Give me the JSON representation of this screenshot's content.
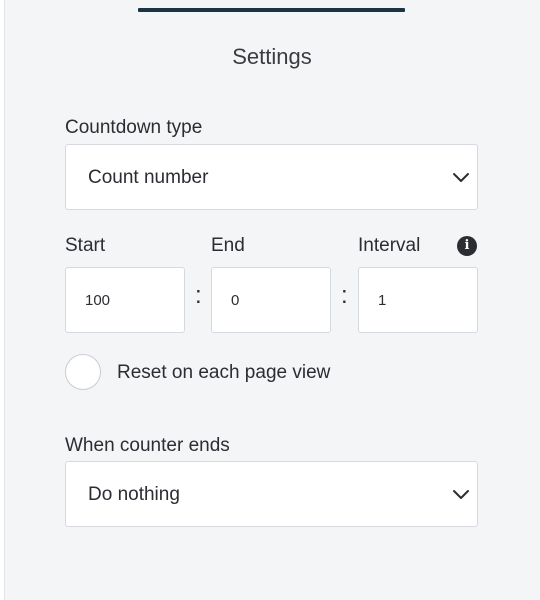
{
  "settings": {
    "title": "Settings",
    "countdown_type": {
      "label": "Countdown type",
      "selected": "Count number"
    },
    "start": {
      "label": "Start",
      "value": "100"
    },
    "end": {
      "label": "End",
      "value": "0"
    },
    "interval": {
      "label": "Interval",
      "value": "1"
    },
    "separator": ":",
    "info_glyph": "i",
    "reset": {
      "label": "Reset on each page view",
      "checked": false
    },
    "when_ends": {
      "label": "When counter ends",
      "selected": "Do nothing"
    }
  },
  "colors": {
    "panel_bg": "#f4f5f7",
    "tab_indicator": "#1d3542",
    "text": "#2b2d33",
    "border": "#d6d9de"
  },
  "icons": [
    "chevron-down-icon",
    "info-icon"
  ]
}
